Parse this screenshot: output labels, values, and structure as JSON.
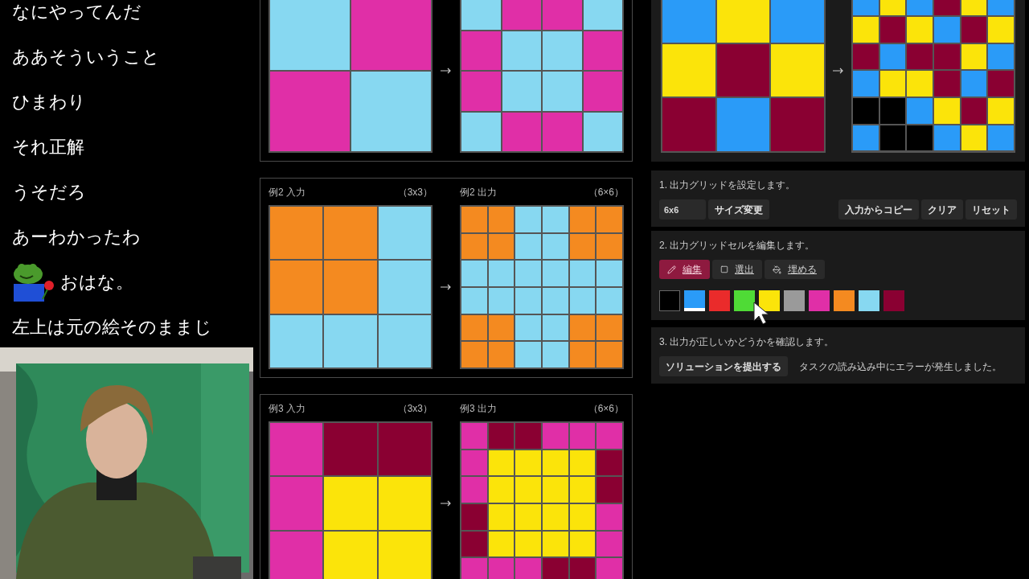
{
  "chat": [
    {
      "text": "なにやってんだ",
      "emote": false
    },
    {
      "text": "ああそういうこと",
      "emote": false
    },
    {
      "text": "ひまわり",
      "emote": false
    },
    {
      "text": "それ正解",
      "emote": false
    },
    {
      "text": "うそだろ",
      "emote": false
    },
    {
      "text": "あーわかったわ",
      "emote": false
    },
    {
      "text": "おはな。",
      "emote": true
    },
    {
      "text": "左上は元の絵そのままじ",
      "emote": false
    }
  ],
  "examples": [
    {
      "input": [
        [
          {
            "color": "#87d8f1"
          },
          {
            "color": "#e02fa7"
          }
        ],
        [
          {
            "color": "#e02fa7"
          },
          {
            "color": "#87d8f1"
          }
        ]
      ],
      "output": [
        [
          {
            "color": "#87d8f1"
          },
          {
            "color": "#e02fa7"
          },
          {
            "color": "#e02fa7"
          },
          {
            "color": "#87d8f1"
          }
        ],
        [
          {
            "color": "#e02fa7"
          },
          {
            "color": "#87d8f1"
          },
          {
            "color": "#87d8f1"
          },
          {
            "color": "#e02fa7"
          }
        ],
        [
          {
            "color": "#e02fa7"
          },
          {
            "color": "#87d8f1"
          },
          {
            "color": "#87d8f1"
          },
          {
            "color": "#e02fa7"
          }
        ],
        [
          {
            "color": "#87d8f1"
          },
          {
            "color": "#e02fa7"
          },
          {
            "color": "#e02fa7"
          },
          {
            "color": "#87d8f1"
          }
        ]
      ]
    },
    {
      "input_label": "例2 入力",
      "input_size": "（3x3）",
      "output_label": "例2 出力",
      "output_size": "（6×6）",
      "input": [
        [
          {
            "color": "#f48a20"
          },
          {
            "color": "#f48a20"
          },
          {
            "color": "#87d8f1"
          }
        ],
        [
          {
            "color": "#f48a20"
          },
          {
            "color": "#f48a20"
          },
          {
            "color": "#87d8f1"
          }
        ],
        [
          {
            "color": "#87d8f1"
          },
          {
            "color": "#87d8f1"
          },
          {
            "color": "#87d8f1"
          }
        ]
      ],
      "output": [
        [
          {
            "color": "#f48a20"
          },
          {
            "color": "#f48a20"
          },
          {
            "color": "#87d8f1"
          },
          {
            "color": "#87d8f1"
          },
          {
            "color": "#f48a20"
          },
          {
            "color": "#f48a20"
          }
        ],
        [
          {
            "color": "#f48a20"
          },
          {
            "color": "#f48a20"
          },
          {
            "color": "#87d8f1"
          },
          {
            "color": "#87d8f1"
          },
          {
            "color": "#f48a20"
          },
          {
            "color": "#f48a20"
          }
        ],
        [
          {
            "color": "#87d8f1"
          },
          {
            "color": "#87d8f1"
          },
          {
            "color": "#87d8f1"
          },
          {
            "color": "#87d8f1"
          },
          {
            "color": "#87d8f1"
          },
          {
            "color": "#87d8f1"
          }
        ],
        [
          {
            "color": "#87d8f1"
          },
          {
            "color": "#87d8f1"
          },
          {
            "color": "#87d8f1"
          },
          {
            "color": "#87d8f1"
          },
          {
            "color": "#87d8f1"
          },
          {
            "color": "#87d8f1"
          }
        ],
        [
          {
            "color": "#f48a20"
          },
          {
            "color": "#f48a20"
          },
          {
            "color": "#87d8f1"
          },
          {
            "color": "#87d8f1"
          },
          {
            "color": "#f48a20"
          },
          {
            "color": "#f48a20"
          }
        ],
        [
          {
            "color": "#f48a20"
          },
          {
            "color": "#f48a20"
          },
          {
            "color": "#87d8f1"
          },
          {
            "color": "#87d8f1"
          },
          {
            "color": "#f48a20"
          },
          {
            "color": "#f48a20"
          }
        ]
      ]
    },
    {
      "input_label": "例3 入力",
      "input_size": "（3x3）",
      "output_label": "例3 出力",
      "output_size": "（6×6）",
      "input": [
        [
          {
            "color": "#e02fa7"
          },
          {
            "color": "#8a0032"
          },
          {
            "color": "#8a0032"
          }
        ],
        [
          {
            "color": "#e02fa7"
          },
          {
            "color": "#fbe40a"
          },
          {
            "color": "#fbe40a"
          }
        ],
        [
          {
            "color": "#e02fa7"
          },
          {
            "color": "#fbe40a"
          },
          {
            "color": "#fbe40a"
          }
        ]
      ],
      "output": [
        [
          {
            "color": "#e02fa7"
          },
          {
            "color": "#8a0032"
          },
          {
            "color": "#8a0032"
          },
          {
            "color": "#e02fa7"
          },
          {
            "color": "#e02fa7"
          },
          {
            "color": "#e02fa7"
          }
        ],
        [
          {
            "color": "#e02fa7"
          },
          {
            "color": "#fbe40a"
          },
          {
            "color": "#fbe40a"
          },
          {
            "color": "#fbe40a"
          },
          {
            "color": "#fbe40a"
          },
          {
            "color": "#8a0032"
          }
        ],
        [
          {
            "color": "#e02fa7"
          },
          {
            "color": "#fbe40a"
          },
          {
            "color": "#fbe40a"
          },
          {
            "color": "#fbe40a"
          },
          {
            "color": "#fbe40a"
          },
          {
            "color": "#8a0032"
          }
        ],
        [
          {
            "color": "#8a0032"
          },
          {
            "color": "#fbe40a"
          },
          {
            "color": "#fbe40a"
          },
          {
            "color": "#fbe40a"
          },
          {
            "color": "#fbe40a"
          },
          {
            "color": "#e02fa7"
          }
        ],
        [
          {
            "color": "#8a0032"
          },
          {
            "color": "#fbe40a"
          },
          {
            "color": "#fbe40a"
          },
          {
            "color": "#fbe40a"
          },
          {
            "color": "#fbe40a"
          },
          {
            "color": "#e02fa7"
          }
        ],
        [
          {
            "color": "#e02fa7"
          },
          {
            "color": "#e02fa7"
          },
          {
            "color": "#e02fa7"
          },
          {
            "color": "#8a0032"
          },
          {
            "color": "#8a0032"
          },
          {
            "color": "#e02fa7"
          }
        ]
      ]
    }
  ],
  "test": {
    "input": [
      [
        {
          "color": "#2a9bf8"
        },
        {
          "color": "#fbe40a"
        },
        {
          "color": "#2a9bf8"
        }
      ],
      [
        {
          "color": "#fbe40a"
        },
        {
          "color": "#8a0032"
        },
        {
          "color": "#fbe40a"
        }
      ],
      [
        {
          "color": "#8a0032"
        },
        {
          "color": "#2a9bf8"
        },
        {
          "color": "#8a0032"
        }
      ]
    ],
    "output": [
      [
        {
          "color": "#2a9bf8"
        },
        {
          "color": "#fbe40a"
        },
        {
          "color": "#2a9bf8"
        },
        {
          "color": "#8a0032"
        },
        {
          "color": "#fbe40a"
        },
        {
          "color": "#2a9bf8"
        }
      ],
      [
        {
          "color": "#fbe40a"
        },
        {
          "color": "#8a0032"
        },
        {
          "color": "#fbe40a"
        },
        {
          "color": "#2a9bf8"
        },
        {
          "color": "#8a0032"
        },
        {
          "color": "#fbe40a"
        }
      ],
      [
        {
          "color": "#8a0032"
        },
        {
          "color": "#2a9bf8"
        },
        {
          "color": "#8a0032"
        },
        {
          "color": "#8a0032"
        },
        {
          "color": "#fbe40a"
        },
        {
          "color": "#2a9bf8"
        }
      ],
      [
        {
          "color": "#2a9bf8"
        },
        {
          "color": "#fbe40a"
        },
        {
          "color": "#fbe40a"
        },
        {
          "color": "#8a0032"
        },
        {
          "color": "#2a9bf8"
        },
        {
          "color": "#8a0032"
        }
      ],
      [
        {
          "color": "#000000"
        },
        {
          "color": "#000000"
        },
        {
          "color": "#2a9bf8"
        },
        {
          "color": "#fbe40a"
        },
        {
          "color": "#8a0032"
        },
        {
          "color": "#fbe40a"
        }
      ],
      [
        {
          "color": "#2a9bf8"
        },
        {
          "color": "#000000"
        },
        {
          "color": "#000000"
        },
        {
          "color": "#2a9bf8"
        },
        {
          "color": "#fbe40a"
        },
        {
          "color": "#2a9bf8"
        }
      ]
    ]
  },
  "step1": {
    "title": "1. 出力グリッドを設定します。",
    "size_value": "6x6",
    "resize": "サイズ変更",
    "buttons": [
      "入力からコピー",
      "クリア",
      "リセット"
    ]
  },
  "step2": {
    "title": "2. 出力グリッドセルを編集します。",
    "tools": [
      {
        "label": "編集",
        "kind": "pencil",
        "selected": true
      },
      {
        "label": "選出",
        "kind": "select",
        "selected": false
      },
      {
        "label": "埋める",
        "kind": "fill",
        "selected": false
      }
    ],
    "palette": [
      {
        "color": "#000000",
        "selected": false
      },
      {
        "color": "#2a9bf8",
        "selected": true
      },
      {
        "color": "#ea2b2b",
        "selected": false
      },
      {
        "color": "#4fdb36",
        "selected": false
      },
      {
        "color": "#fbe40a",
        "selected": false
      },
      {
        "color": "#9a9a9a",
        "selected": false
      },
      {
        "color": "#e02fa7",
        "selected": false
      },
      {
        "color": "#f48a20",
        "selected": false
      },
      {
        "color": "#87d8f1",
        "selected": false
      },
      {
        "color": "#8a0032",
        "selected": false
      }
    ]
  },
  "step3": {
    "title": "3. 出力が正しいかどうかを確認します。",
    "submit": "ソリューションを提出する",
    "message": "タスクの読み込み中にエラーが発生しました。"
  }
}
